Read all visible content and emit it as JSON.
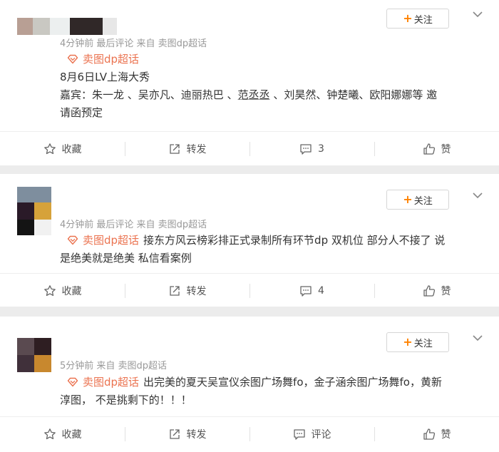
{
  "posts": [
    {
      "meta": "4分钟前 最后评论 来自 卖图dp超话",
      "follow_label": "关注",
      "tag": "卖图dp超话",
      "line1": "8月6日LV上海大秀",
      "line2a": "嘉宾：朱一龙 、吴亦凡、迪丽热巴 、",
      "line2b": "范丞丞",
      "line2c": " 、刘昊然、钟楚曦、欧阳娜娜等 邀",
      "line3": "请函预定",
      "actions": {
        "collect": "收藏",
        "forward": "转发",
        "comment": "3",
        "like": "赞"
      }
    },
    {
      "meta": "4分钟前 最后评论 来自 卖图dp超话",
      "follow_label": "关注",
      "tag": "卖图dp超话",
      "text1": "接东方风云榜彩排正式录制所有环节dp 双机位 部分人不接了 说",
      "text2": "是绝美就是绝美 私信看案例",
      "actions": {
        "collect": "收藏",
        "forward": "转发",
        "comment": "4",
        "like": "赞"
      }
    },
    {
      "meta": "5分钟前 来自 卖图dp超话",
      "follow_label": "关注",
      "tag": "卖图dp超话",
      "text1": "出完美的夏天吴宣仪余图广场舞fo，金子涵余图广场舞fo，黄新",
      "text2": "淳图， 不是挑剩下的！！！",
      "actions": {
        "collect": "收藏",
        "forward": "转发",
        "comment": "评论",
        "like": "赞"
      }
    }
  ],
  "colors": {
    "accent": "#ff8200",
    "tag": "#eb7350",
    "meta": "#999999"
  },
  "icons": [
    "star-icon",
    "forward-icon",
    "comment-icon",
    "like-icon",
    "chevron-down-icon",
    "tag-icon"
  ]
}
